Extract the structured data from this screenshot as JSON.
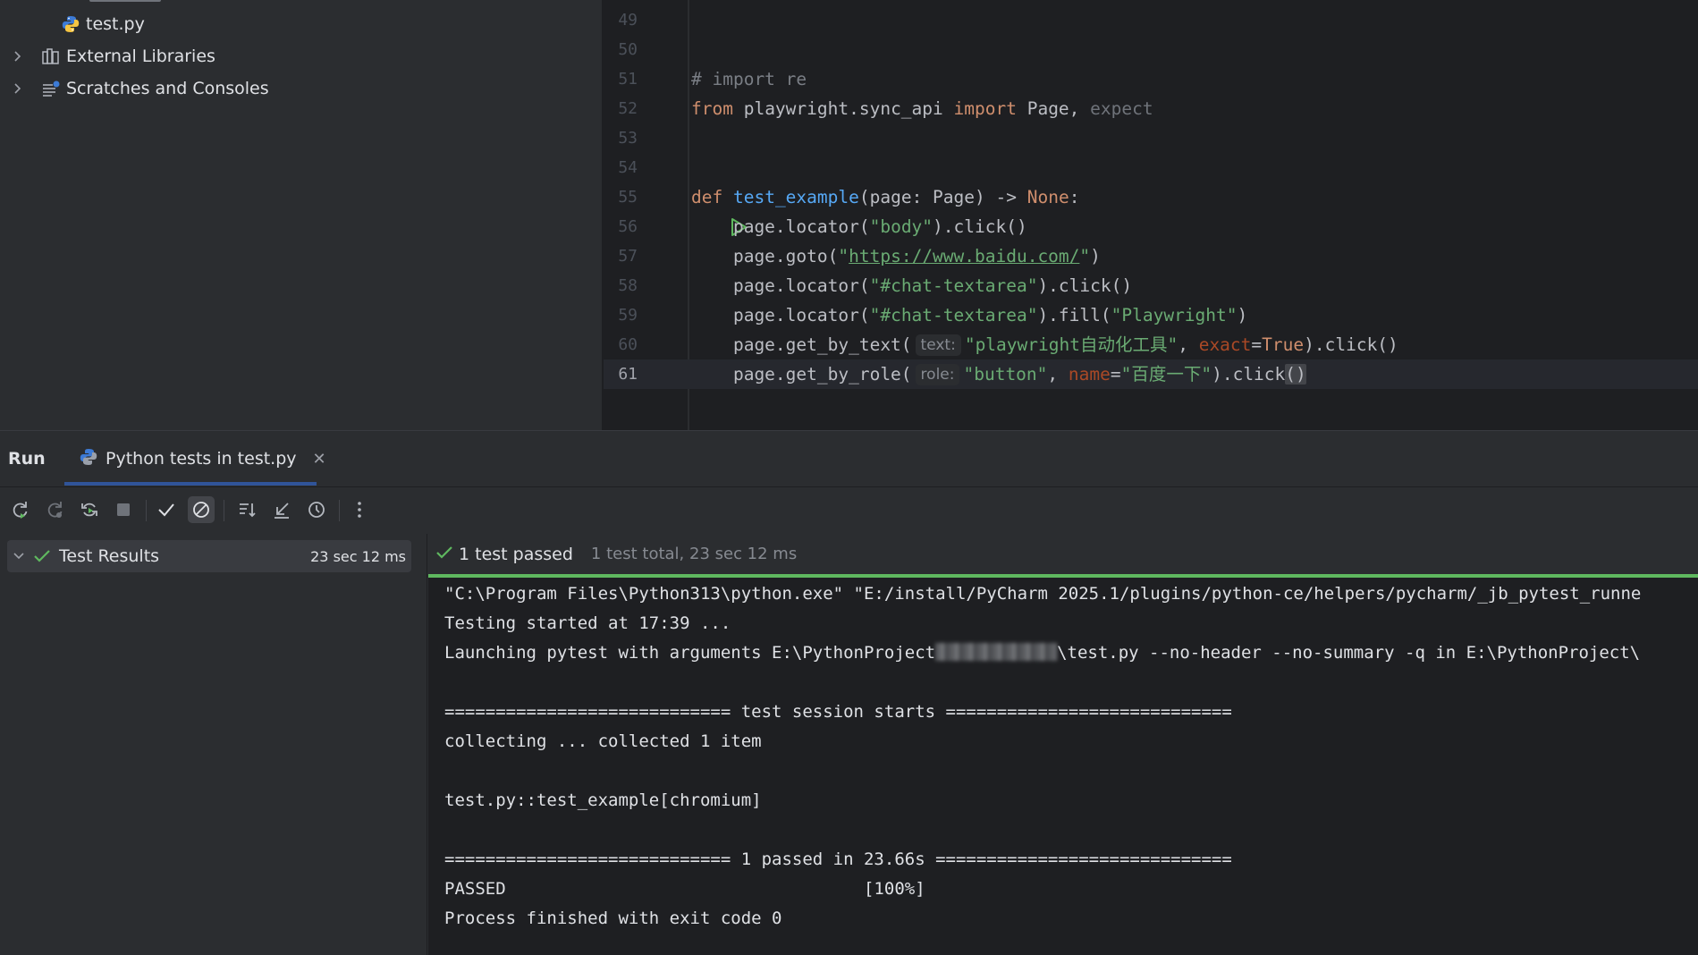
{
  "project_tree": {
    "items": [
      {
        "label": "test.py",
        "icon": "python-file-icon"
      },
      {
        "label": "External Libraries",
        "icon": "library-icon"
      },
      {
        "label": "Scratches and Consoles",
        "icon": "scratches-icon"
      }
    ]
  },
  "editor": {
    "lines": [
      {
        "n": "49"
      },
      {
        "n": "50"
      },
      {
        "n": "51"
      },
      {
        "n": "52"
      },
      {
        "n": "53"
      },
      {
        "n": "54"
      },
      {
        "n": "55"
      },
      {
        "n": "56"
      },
      {
        "n": "57"
      },
      {
        "n": "58"
      },
      {
        "n": "59"
      },
      {
        "n": "60"
      },
      {
        "n": "61"
      }
    ],
    "code": {
      "l51": "# import re",
      "l52_kw1": "from",
      "l52_mod": " playwright.sync_api ",
      "l52_kw2": "import",
      "l52_rest": " Page, ",
      "l52_unused": "expect",
      "l55_kw": "def",
      "l55_fn": "test_example",
      "l55_a": "(page: Page) -> ",
      "l55_none": "None",
      "l55_b": ":",
      "l56_a": "    page.locator(",
      "l56_s": "\"body\"",
      "l56_b": ").click()",
      "l57_a": "    page.goto(",
      "l57_q1": "\"",
      "l57_url": "https://www.baidu.com/",
      "l57_q2": "\"",
      "l57_b": ")",
      "l58_a": "    page.locator(",
      "l58_s": "\"#chat-textarea\"",
      "l58_b": ").click()",
      "l59_a": "    page.locator(",
      "l59_s1": "\"#chat-textarea\"",
      "l59_b": ").fill(",
      "l59_s2": "\"Playwright\"",
      "l59_c": ")",
      "l60_a": "    page.get_by_text(",
      "l60_hint": "text:",
      "l60_s": "\"playwright自动化工具\"",
      "l60_b": ", ",
      "l60_p": "exact",
      "l60_c": "=",
      "l60_true": "True",
      "l60_d": ").click()",
      "l61_a": "    page.get_by_role(",
      "l61_hint": "role:",
      "l61_s1": "\"button\"",
      "l61_b": ", ",
      "l61_p": "name",
      "l61_c": "=",
      "l61_s2": "\"百度一下\"",
      "l61_d": ").click",
      "l61_e": "()"
    }
  },
  "run_panel": {
    "title": "Run",
    "tab_label": "Python tests in test.py",
    "tab_close": "✕"
  },
  "results": {
    "root_label": "Test Results",
    "root_time": "23 sec 12 ms"
  },
  "console": {
    "status_passed": "1 test passed",
    "status_total": "1 test total, 23 sec 12 ms",
    "progress_fraction": 1.0,
    "lines": [
      "\"C:\\Program Files\\Python313\\python.exe\" \"E:/install/PyCharm 2025.1/plugins/python-ce/helpers/pycharm/_jb_pytest_runne",
      "Testing started at 17:39 ...",
      "",
      "",
      "============================ test session starts ============================",
      "collecting ... collected 1 item",
      "",
      "test.py::test_example[chromium]",
      "",
      "============================ 1 passed in 23.66s =============================",
      "PASSED                                   [100%]",
      "Process finished with exit code 0"
    ],
    "launch_a": "Launching pytest with arguments E:\\PythonProject",
    "launch_b": "\\test.py --no-header --no-summary -q in E:\\PythonProject\\"
  },
  "colors": {
    "accent": "#3574f0",
    "success": "#5fb85f",
    "keyword": "#cf8e6d",
    "string": "#6aab73",
    "function": "#56a8f5"
  }
}
